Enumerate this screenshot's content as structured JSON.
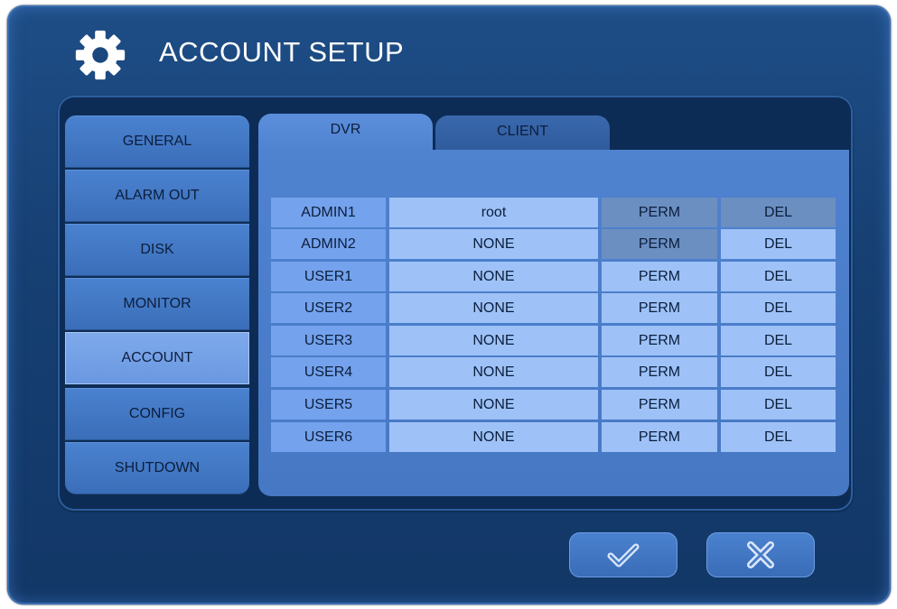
{
  "header": {
    "title": "ACCOUNT SETUP",
    "icon": "gear-icon"
  },
  "sidebar": {
    "items": [
      {
        "label": "GENERAL",
        "active": false
      },
      {
        "label": "ALARM OUT",
        "active": false
      },
      {
        "label": "DISK",
        "active": false
      },
      {
        "label": "MONITOR",
        "active": false
      },
      {
        "label": "ACCOUNT",
        "active": true
      },
      {
        "label": "CONFIG",
        "active": false
      },
      {
        "label": "SHUTDOWN",
        "active": false
      }
    ]
  },
  "tabs": [
    {
      "label": "DVR",
      "active": true
    },
    {
      "label": "CLIENT",
      "active": false
    }
  ],
  "accounts": [
    {
      "user": "ADMIN1",
      "password": "root",
      "perm": "PERM",
      "del": "DEL"
    },
    {
      "user": "ADMIN2",
      "password": "NONE",
      "perm": "PERM",
      "del": "DEL"
    },
    {
      "user": "USER1",
      "password": "NONE",
      "perm": "PERM",
      "del": "DEL"
    },
    {
      "user": "USER2",
      "password": "NONE",
      "perm": "PERM",
      "del": "DEL"
    },
    {
      "user": "USER3",
      "password": "NONE",
      "perm": "PERM",
      "del": "DEL"
    },
    {
      "user": "USER4",
      "password": "NONE",
      "perm": "PERM",
      "del": "DEL"
    },
    {
      "user": "USER5",
      "password": "NONE",
      "perm": "PERM",
      "del": "DEL"
    },
    {
      "user": "USER6",
      "password": "NONE",
      "perm": "PERM",
      "del": "DEL"
    }
  ],
  "footer": {
    "ok_icon": "check-icon",
    "cancel_icon": "close-icon"
  },
  "colors": {
    "background": "#163f72",
    "active_item": "#7ea9ec",
    "cell": "#9ec2f7",
    "user_cell": "#74a2ec"
  }
}
